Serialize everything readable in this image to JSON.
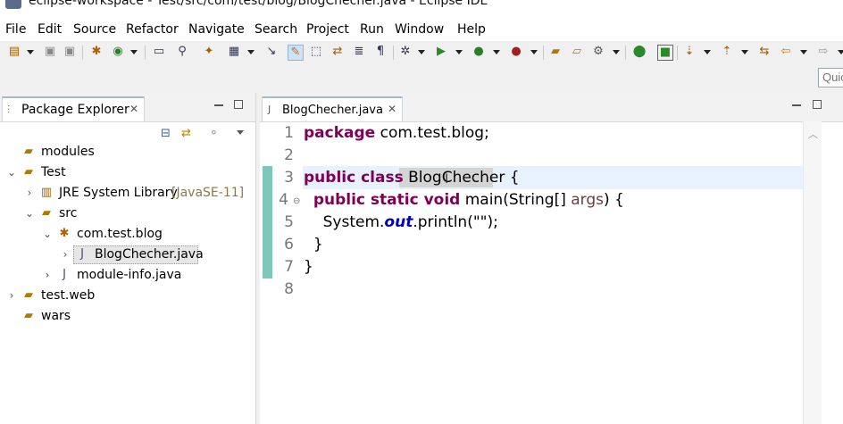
{
  "window": {
    "title": "eclipse-workspace - Test/src/com/test/blog/BlogChecher.java - Eclipse IDE"
  },
  "menu": [
    "File",
    "Edit",
    "Source",
    "Refactor",
    "Navigate",
    "Search",
    "Project",
    "Run",
    "Window",
    "Help"
  ],
  "quick_access": {
    "placeholder": "Quic"
  },
  "package_explorer": {
    "tab_label": "Package Explorer",
    "tree": [
      {
        "label": "modules",
        "suffix": "",
        "icon": "folder-icon",
        "twisty": ""
      },
      {
        "label": "Test",
        "suffix": "",
        "icon": "project-icon",
        "twisty": "expanded"
      },
      {
        "label": "JRE System Library",
        "suffix": "[JavaSE-11]",
        "icon": "library-icon",
        "twisty": "collapsed"
      },
      {
        "label": "src",
        "suffix": "",
        "icon": "source-folder-icon",
        "twisty": "expanded"
      },
      {
        "label": "com.test.blog",
        "suffix": "",
        "icon": "package-icon",
        "twisty": "expanded"
      },
      {
        "label": "BlogChecher.java",
        "suffix": "",
        "icon": "java-file-icon",
        "twisty": "collapsed"
      },
      {
        "label": "module-info.java",
        "suffix": "",
        "icon": "java-file-icon",
        "twisty": "collapsed"
      },
      {
        "label": "test.web",
        "suffix": "",
        "icon": "project-icon",
        "twisty": "collapsed"
      },
      {
        "label": "wars",
        "suffix": "",
        "icon": "folder-icon",
        "twisty": ""
      }
    ],
    "selected": "BlogChecher.java"
  },
  "editor": {
    "tab_label": "BlogChecher.java",
    "line_numbers": [
      "1",
      "2",
      "3",
      "4",
      "5",
      "6",
      "7",
      "8"
    ],
    "code": {
      "l1_kw": "package",
      "l1_rest": " com.test.blog;",
      "l3_kw": "public class",
      "l3_name": "BlogChecher",
      "l3_rest": " {",
      "l4_kw": "public static void",
      "l4_rest1": " main(String[] ",
      "l4_param": "args",
      "l4_rest2": ") {",
      "l5_a": "System.",
      "l5_field": "out",
      "l5_b": ".println(",
      "l5_str": "\"\"",
      "l5_c": ");",
      "l6": "}",
      "l7": "}"
    }
  },
  "colors": {
    "keyword": "#7f0055",
    "string": "#2a00ff",
    "field": "#0000c0",
    "change_bar": "#7ec7ba",
    "current_line": "#e8f2fe"
  }
}
